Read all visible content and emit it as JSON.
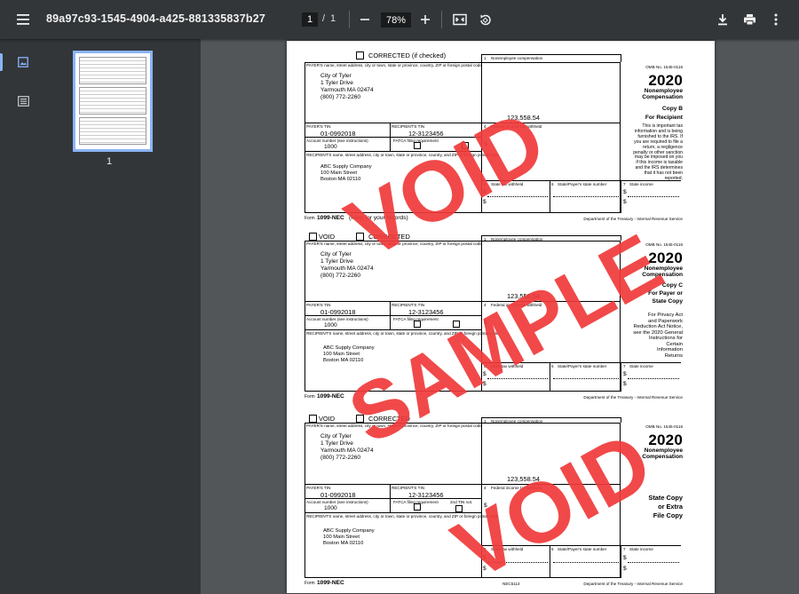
{
  "toolbar": {
    "title": "89a97c93-1545-4904-a425-881335837b27",
    "page_current": "1",
    "page_separator": "/",
    "page_total": "1",
    "zoom": "78%",
    "icons": [
      "menu-icon",
      "zoom-out-icon",
      "zoom-in-icon",
      "fit-page-icon",
      "rotate-icon",
      "download-icon",
      "print-icon",
      "more-vert-icon"
    ]
  },
  "sidebar": {
    "thumbnail_label": "1",
    "icons": [
      "thumbnail-view-icon",
      "outline-view-icon"
    ]
  },
  "form": {
    "corrected_if_checked": "CORRECTED (if checked)",
    "void": "VOID",
    "corrected": "CORRECTED",
    "payer_name_label": "PAYER'S name, street address, city or town, state or province, country, ZIP or foreign postal code",
    "payer_name": "City of Tyler",
    "payer_street": "1 Tyler Drive",
    "payer_city": "Yarmouth MA 02474",
    "payer_phone": "(800) 772-2260",
    "payer_tin_label": "PAYER'S TIN",
    "payer_tin": "01-0992018",
    "recipient_tin_label": "RECIPIENT'S TIN",
    "recipient_tin": "12-3123456",
    "account_label": "Account number (see instructions)",
    "account": "1000",
    "fatca_label": "FATCA filing requirement",
    "second_tin_label": "2nd TIN not.",
    "recipient_name_label": "RECIPIENT'S name, street address, city or town, state or province, country, and ZIP or foreign postal code",
    "recipient_name": "ABC Supply Company",
    "recipient_street": "100 Main Street",
    "recipient_city": "Boston MA 02110",
    "box1_num": "1",
    "box1_label": "Nonemployee compensation",
    "box1_value": "123,558.54",
    "box4_num": "4",
    "box4_label": "Federal income tax withheld",
    "dollar": "$",
    "box5_num": "5",
    "box5_label": "State tax withheld",
    "box6_num": "6",
    "box6_label": "State/Payer's state number",
    "box7_num": "7",
    "box7_label": "State income",
    "omb": "OMB No. 1545-0116",
    "year": "2020",
    "form_title_1": "Nonemployee",
    "form_title_2": "Compensation",
    "form_word": "Form",
    "form_name": "1099-NEC",
    "keep_records": "(keep for your records)",
    "dept": "Department of the Treasury - Internal Revenue Service",
    "cat_code": "NEC5114"
  },
  "copy_b": {
    "copy": "Copy B",
    "for": "For Recipient",
    "notice": [
      "This is important tax",
      "information and is being",
      "furnished to the IRS. If",
      "you are required to file a",
      "return, a negligence",
      "penalty or other sanction",
      "may be imposed on you",
      "if this income is taxable",
      "and the IRS determines",
      "that it has not been",
      "reported."
    ]
  },
  "copy_c": {
    "copy": "Copy C",
    "for_1": "For Payer or",
    "for_2": "State Copy",
    "notice": [
      "For Privacy Act",
      "and Paperwork",
      "Reduction Act Notice,",
      "see the 2020 General",
      "Instructions for",
      "Certain",
      "Information",
      "Returns"
    ]
  },
  "copy_state": {
    "line1": "State Copy",
    "line2": "or Extra",
    "line3": "File Copy"
  },
  "watermarks": {
    "void_top": "VOID",
    "sample": "SAMPLE",
    "void_bottom": "VOID",
    "color": "#f03a3a"
  }
}
